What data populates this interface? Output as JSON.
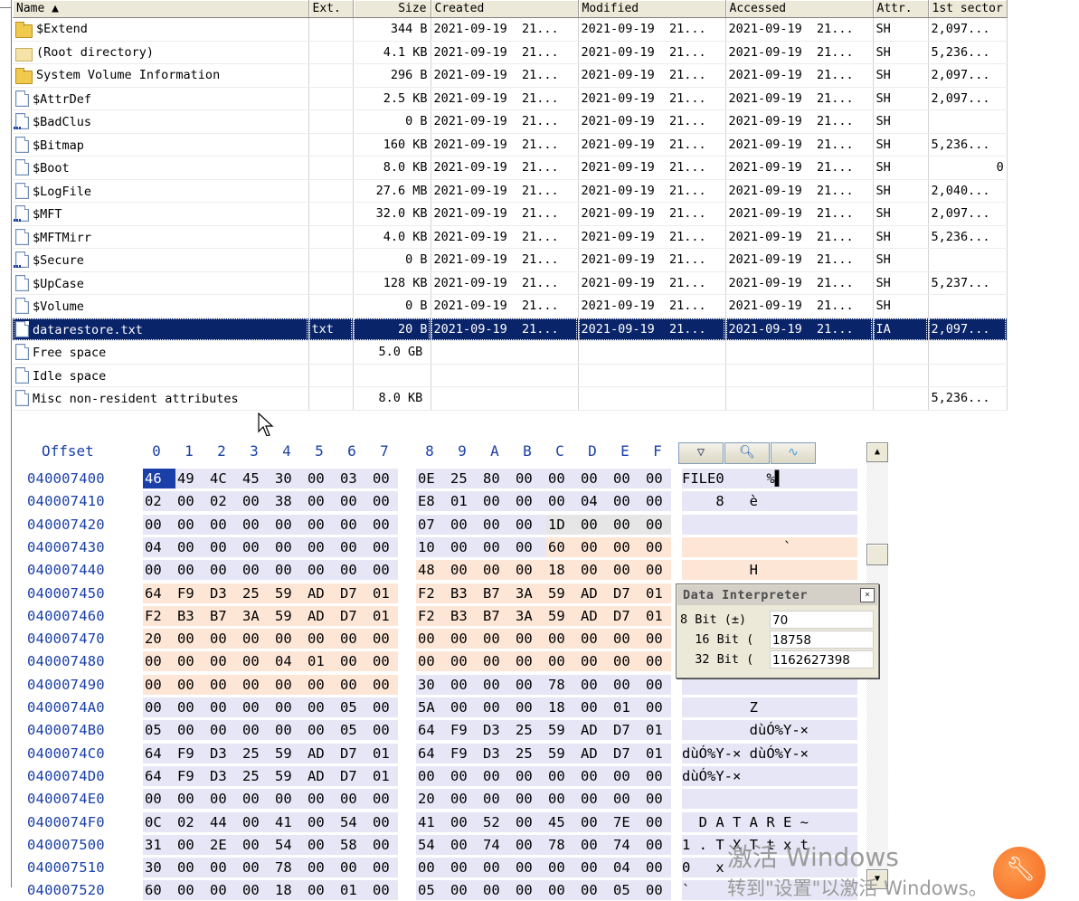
{
  "file_list": {
    "columns": [
      {
        "key": "name",
        "label": "Name ▲",
        "width": 327,
        "align": "left"
      },
      {
        "key": "ext",
        "label": "Ext.",
        "width": 49,
        "align": "left"
      },
      {
        "key": "size",
        "label": "Size",
        "width": 86,
        "align": "right"
      },
      {
        "key": "created",
        "label": "Created",
        "width": 163,
        "align": "left"
      },
      {
        "key": "modified",
        "label": "Modified",
        "width": 163,
        "align": "left"
      },
      {
        "key": "accessed",
        "label": "Accessed",
        "width": 163,
        "align": "left"
      },
      {
        "key": "attr",
        "label": "Attr.",
        "width": 61,
        "align": "left"
      },
      {
        "key": "sector",
        "label": "1st sector",
        "width": 82,
        "align": "left"
      }
    ],
    "rows": [
      {
        "icon": "folder",
        "name": "$Extend",
        "ext": "",
        "size": "344 B",
        "created": "2021-09-19  21...",
        "modified": "2021-09-19  21...",
        "accessed": "2021-09-19  21...",
        "attr": "SH",
        "sector": "2,097...",
        "sector_align": "left"
      },
      {
        "icon": "rootfolder",
        "name": "(Root directory)",
        "ext": "",
        "size": "4.1 KB",
        "created": "2021-09-19  21...",
        "modified": "2021-09-19  21...",
        "accessed": "2021-09-19  21...",
        "attr": "SH",
        "sector": "5,236...",
        "sector_align": "left"
      },
      {
        "icon": "folder",
        "name": "System Volume Information",
        "ext": "",
        "size": "296 B",
        "created": "2021-09-19  21...",
        "modified": "2021-09-19  21...",
        "accessed": "2021-09-19  21...",
        "attr": "SH",
        "sector": "2,097...",
        "sector_align": "left"
      },
      {
        "icon": "doc",
        "name": "$AttrDef",
        "ext": "",
        "size": "2.5 KB",
        "created": "2021-09-19  21...",
        "modified": "2021-09-19  21...",
        "accessed": "2021-09-19  21...",
        "attr": "SH",
        "sector": "2,097...",
        "sector_align": "left"
      },
      {
        "icon": "doc-dots",
        "name": "$BadClus",
        "ext": "",
        "size": "0 B",
        "created": "2021-09-19  21...",
        "modified": "2021-09-19  21...",
        "accessed": "2021-09-19  21...",
        "attr": "SH",
        "sector": "",
        "sector_align": "left"
      },
      {
        "icon": "doc",
        "name": "$Bitmap",
        "ext": "",
        "size": "160 KB",
        "created": "2021-09-19  21...",
        "modified": "2021-09-19  21...",
        "accessed": "2021-09-19  21...",
        "attr": "SH",
        "sector": "5,236...",
        "sector_align": "left"
      },
      {
        "icon": "doc",
        "name": "$Boot",
        "ext": "",
        "size": "8.0 KB",
        "created": "2021-09-19  21...",
        "modified": "2021-09-19  21...",
        "accessed": "2021-09-19  21...",
        "attr": "SH",
        "sector": "0",
        "sector_align": "right"
      },
      {
        "icon": "doc",
        "name": "$LogFile",
        "ext": "",
        "size": "27.6 MB",
        "created": "2021-09-19  21...",
        "modified": "2021-09-19  21...",
        "accessed": "2021-09-19  21...",
        "attr": "SH",
        "sector": "2,040...",
        "sector_align": "left"
      },
      {
        "icon": "doc-dots",
        "name": "$MFT",
        "ext": "",
        "size": "32.0 KB",
        "created": "2021-09-19  21...",
        "modified": "2021-09-19  21...",
        "accessed": "2021-09-19  21...",
        "attr": "SH",
        "sector": "2,097...",
        "sector_align": "left"
      },
      {
        "icon": "doc",
        "name": "$MFTMirr",
        "ext": "",
        "size": "4.0 KB",
        "created": "2021-09-19  21...",
        "modified": "2021-09-19  21...",
        "accessed": "2021-09-19  21...",
        "attr": "SH",
        "sector": "5,236...",
        "sector_align": "left"
      },
      {
        "icon": "doc-dots",
        "name": "$Secure",
        "ext": "",
        "size": "0 B",
        "created": "2021-09-19  21...",
        "modified": "2021-09-19  21...",
        "accessed": "2021-09-19  21...",
        "attr": "SH",
        "sector": "",
        "sector_align": "left"
      },
      {
        "icon": "doc",
        "name": "$UpCase",
        "ext": "",
        "size": "128 KB",
        "created": "2021-09-19  21...",
        "modified": "2021-09-19  21...",
        "accessed": "2021-09-19  21...",
        "attr": "SH",
        "sector": "5,237...",
        "sector_align": "left"
      },
      {
        "icon": "doc",
        "name": "$Volume",
        "ext": "",
        "size": "0 B",
        "created": "2021-09-19  21...",
        "modified": "2021-09-19  21...",
        "accessed": "2021-09-19  21...",
        "attr": "SH",
        "sector": "",
        "sector_align": "left"
      },
      {
        "icon": "doc",
        "name": "datarestore.txt",
        "ext": "txt",
        "size": "20 B",
        "created": "2021-09-19  21...",
        "modified": "2021-09-19  21...",
        "accessed": "2021-09-19  21...",
        "attr": "IA",
        "sector": "2,097...",
        "sector_align": "left",
        "selected": true
      },
      {
        "icon": "doc",
        "name": "Free space",
        "ext": "",
        "size": "5.0 GB",
        "size_align": "left",
        "created": "",
        "modified": "",
        "accessed": "",
        "attr": "",
        "sector": "",
        "sector_align": "left"
      },
      {
        "icon": "doc",
        "name": "Idle space",
        "ext": "",
        "size": "",
        "created": "",
        "modified": "",
        "accessed": "",
        "attr": "",
        "sector": "",
        "sector_align": "left"
      },
      {
        "icon": "doc",
        "name": "Misc non-resident attributes",
        "ext": "",
        "size": "8.0 KB",
        "size_align": "left",
        "created": "",
        "modified": "",
        "accessed": "",
        "attr": "",
        "sector": "5,236...",
        "sector_align": "left"
      }
    ]
  },
  "hex": {
    "header_offset": "Offset",
    "header_cols": [
      "0",
      "1",
      "2",
      "3",
      "4",
      "5",
      "6",
      "7",
      "8",
      "9",
      "A",
      "B",
      "C",
      "D",
      "E",
      "F"
    ],
    "rows": [
      {
        "off": "040007400",
        "bytes": [
          "46",
          "49",
          "4C",
          "45",
          "30",
          "00",
          "03",
          "00",
          "0E",
          "25",
          "80",
          "00",
          "00",
          "00",
          "00",
          "00"
        ],
        "text": "FILE0     %▌"
      },
      {
        "off": "040007410",
        "bytes": [
          "02",
          "00",
          "02",
          "00",
          "38",
          "00",
          "00",
          "00",
          "E8",
          "01",
          "00",
          "00",
          "00",
          "04",
          "00",
          "00"
        ],
        "text": "    8   è"
      },
      {
        "off": "040007420",
        "bytes": [
          "00",
          "00",
          "00",
          "00",
          "00",
          "00",
          "00",
          "00",
          "07",
          "00",
          "00",
          "00",
          "1D",
          "00",
          "00",
          "00"
        ],
        "text": ""
      },
      {
        "off": "040007430",
        "bytes": [
          "04",
          "00",
          "00",
          "00",
          "00",
          "00",
          "00",
          "00",
          "10",
          "00",
          "00",
          "00",
          "60",
          "00",
          "00",
          "00"
        ],
        "text": "            `"
      },
      {
        "off": "040007440",
        "bytes": [
          "00",
          "00",
          "00",
          "00",
          "00",
          "00",
          "00",
          "00",
          "48",
          "00",
          "00",
          "00",
          "18",
          "00",
          "00",
          "00"
        ],
        "text": "        H"
      },
      {
        "off": "040007450",
        "bytes": [
          "64",
          "F9",
          "D3",
          "25",
          "59",
          "AD",
          "D7",
          "01",
          "F2",
          "B3",
          "B7",
          "3A",
          "59",
          "AD",
          "D7",
          "01"
        ],
        "text": ""
      },
      {
        "off": "040007460",
        "bytes": [
          "F2",
          "B3",
          "B7",
          "3A",
          "59",
          "AD",
          "D7",
          "01",
          "F2",
          "B3",
          "B7",
          "3A",
          "59",
          "AD",
          "D7",
          "01"
        ],
        "text": ""
      },
      {
        "off": "040007470",
        "bytes": [
          "20",
          "00",
          "00",
          "00",
          "00",
          "00",
          "00",
          "00",
          "00",
          "00",
          "00",
          "00",
          "00",
          "00",
          "00",
          "00"
        ],
        "text": ""
      },
      {
        "off": "040007480",
        "bytes": [
          "00",
          "00",
          "00",
          "00",
          "04",
          "01",
          "00",
          "00",
          "00",
          "00",
          "00",
          "00",
          "00",
          "00",
          "00",
          "00"
        ],
        "text": ""
      },
      {
        "off": "040007490",
        "bytes": [
          "00",
          "00",
          "00",
          "00",
          "00",
          "00",
          "00",
          "00",
          "30",
          "00",
          "00",
          "00",
          "78",
          "00",
          "00",
          "00"
        ],
        "text": ""
      },
      {
        "off": "0400074A0",
        "bytes": [
          "00",
          "00",
          "00",
          "00",
          "00",
          "00",
          "05",
          "00",
          "5A",
          "00",
          "00",
          "00",
          "18",
          "00",
          "01",
          "00"
        ],
        "text": "        Z"
      },
      {
        "off": "0400074B0",
        "bytes": [
          "05",
          "00",
          "00",
          "00",
          "00",
          "00",
          "05",
          "00",
          "64",
          "F9",
          "D3",
          "25",
          "59",
          "AD",
          "D7",
          "01"
        ],
        "text": "        dùÓ%Y-×"
      },
      {
        "off": "0400074C0",
        "bytes": [
          "64",
          "F9",
          "D3",
          "25",
          "59",
          "AD",
          "D7",
          "01",
          "64",
          "F9",
          "D3",
          "25",
          "59",
          "AD",
          "D7",
          "01"
        ],
        "text": "dùÓ%Y-× dùÓ%Y-×"
      },
      {
        "off": "0400074D0",
        "bytes": [
          "64",
          "F9",
          "D3",
          "25",
          "59",
          "AD",
          "D7",
          "01",
          "00",
          "00",
          "00",
          "00",
          "00",
          "00",
          "00",
          "00"
        ],
        "text": "dùÓ%Y-×"
      },
      {
        "off": "0400074E0",
        "bytes": [
          "00",
          "00",
          "00",
          "00",
          "00",
          "00",
          "00",
          "00",
          "20",
          "00",
          "00",
          "00",
          "00",
          "00",
          "00",
          "00"
        ],
        "text": ""
      },
      {
        "off": "0400074F0",
        "bytes": [
          "0C",
          "02",
          "44",
          "00",
          "41",
          "00",
          "54",
          "00",
          "41",
          "00",
          "52",
          "00",
          "45",
          "00",
          "7E",
          "00"
        ],
        "text": "  D A T A R E ~"
      },
      {
        "off": "040007500",
        "bytes": [
          "31",
          "00",
          "2E",
          "00",
          "54",
          "00",
          "58",
          "00",
          "54",
          "00",
          "74",
          "00",
          "78",
          "00",
          "74",
          "00"
        ],
        "text": "1 . T X T t x t"
      },
      {
        "off": "040007510",
        "bytes": [
          "30",
          "00",
          "00",
          "00",
          "78",
          "00",
          "00",
          "00",
          "00",
          "00",
          "00",
          "00",
          "00",
          "00",
          "04",
          "00"
        ],
        "text": "0   x"
      },
      {
        "off": "040007520",
        "bytes": [
          "60",
          "00",
          "00",
          "00",
          "18",
          "00",
          "01",
          "00",
          "05",
          "00",
          "00",
          "00",
          "00",
          "00",
          "05",
          "00"
        ],
        "text": "`"
      }
    ]
  },
  "data_interpreter": {
    "title": "Data Interpreter",
    "close_glyph": "×",
    "rows": [
      {
        "label": "8 Bit (±)",
        "value": "70"
      },
      {
        "label": "  16 Bit (",
        "value": "18758"
      },
      {
        "label": "  32 Bit (",
        "value": "1162627398"
      }
    ]
  },
  "watermark": {
    "line1": "激活 Windows",
    "line2": "转到\"设置\"以激活 Windows。"
  },
  "colors": {
    "selection": "#0a246a",
    "offset_text": "#1a3fa8",
    "highlight_lavender": "#e6e6f6",
    "highlight_peach": "#fde6d6",
    "highlight_gray": "#e6e6e6"
  }
}
